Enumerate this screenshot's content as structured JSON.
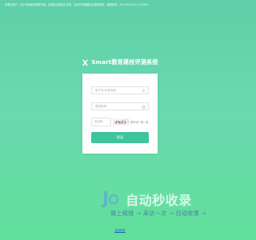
{
  "notice": {
    "text": "亲爱的用户，由于系统版本更新升级，如遇到页面显示异常，请及时清理缓存后重新登录，客服热线：400-9919170（15263）"
  },
  "brand": {
    "title": "Smart教育建校评测系统",
    "logo_icon": "x-logo-icon"
  },
  "login": {
    "username_placeholder": "用户名/手机号码",
    "password_placeholder": "登录密码",
    "captcha_placeholder": "验证码",
    "captcha_code": "4XZ1",
    "refresh_label": "看不清？换一张",
    "submit_label": "登录"
  },
  "watermark": {
    "logo_text": "J",
    "title": "自动秒收录",
    "subtitle": "做上链接 → 来访一次 → 自动收录 →"
  },
  "footer": {
    "link_text": "自动秒收"
  },
  "colors": {
    "accent": "#3fc49c",
    "background": "#62d9a8"
  }
}
